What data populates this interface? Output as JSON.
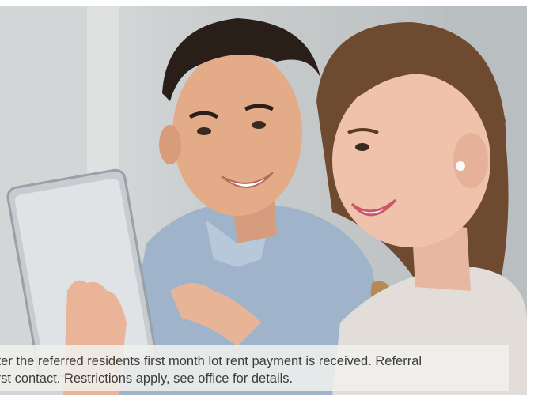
{
  "hero": {
    "image": "couple-using-tablet-photo",
    "caption": {
      "line1": "fter the referred residents first month lot rent payment is received. Referral",
      "line2": "irst contact. Restrictions apply, see office for details."
    }
  }
}
